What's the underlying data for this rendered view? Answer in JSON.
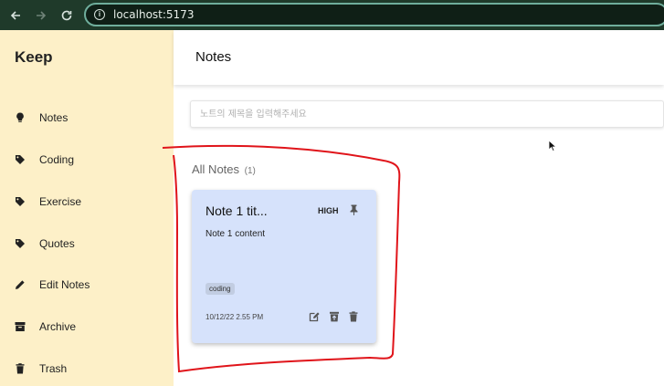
{
  "browser": {
    "url": "localhost:5173"
  },
  "sidebar": {
    "brand": "Keep",
    "items": [
      {
        "label": "Notes",
        "icon": "lightbulb-icon"
      },
      {
        "label": "Coding",
        "icon": "tag-icon"
      },
      {
        "label": "Exercise",
        "icon": "tag-icon"
      },
      {
        "label": "Quotes",
        "icon": "tag-icon"
      },
      {
        "label": "Edit Notes",
        "icon": "pencil-icon"
      },
      {
        "label": "Archive",
        "icon": "archive-icon"
      },
      {
        "label": "Trash",
        "icon": "trash-icon"
      }
    ]
  },
  "header": {
    "title": "Notes"
  },
  "search": {
    "placeholder": "노트의 제목을 입력해주세요"
  },
  "section": {
    "title": "All Notes",
    "count": "(1)"
  },
  "note": {
    "title": "Note 1 tit...",
    "priority": "HIGH",
    "content": "Note 1 content",
    "tag": "coding",
    "date": "10/12/22 2.55 PM",
    "background": "#d6e2fb"
  },
  "colors": {
    "sidebar": "#fdf0c8",
    "annotation": "#e0141a"
  }
}
